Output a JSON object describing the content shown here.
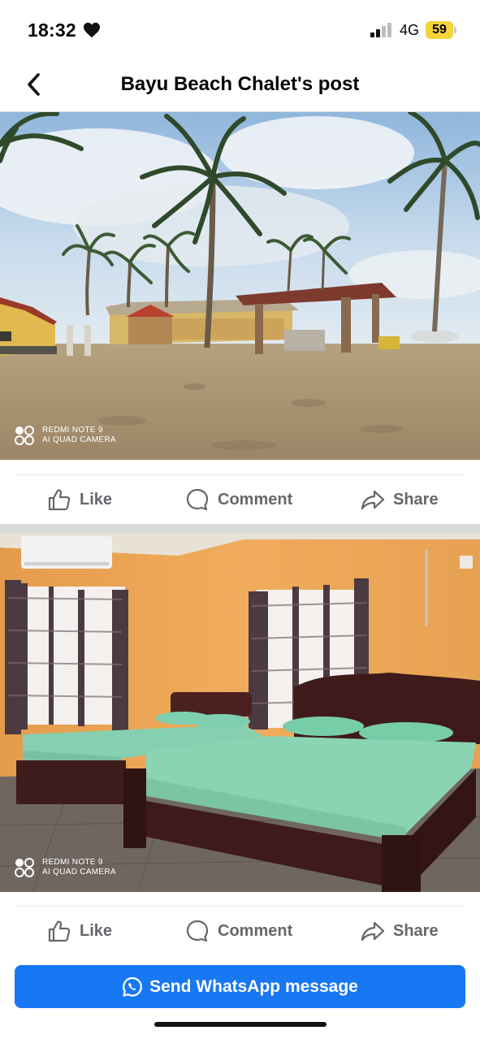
{
  "status_bar": {
    "time": "18:32",
    "network": "4G",
    "battery": "59"
  },
  "header": {
    "title": "Bayu Beach Chalet's post",
    "back_icon": "chevron-left-icon"
  },
  "posts": [
    {
      "image_description": "beach chalets with coconut palms",
      "watermark_line1": "REDMI NOTE 9",
      "watermark_line2": "AI QUAD CAMERA",
      "actions": {
        "like": "Like",
        "comment": "Comment",
        "share": "Share"
      }
    },
    {
      "image_description": "bedroom with two beds",
      "watermark_line1": "REDMI NOTE 9",
      "watermark_line2": "AI QUAD CAMERA",
      "actions": {
        "like": "Like",
        "comment": "Comment",
        "share": "Share"
      }
    }
  ],
  "cta": {
    "label": "Send WhatsApp message",
    "icon": "whatsapp-icon"
  },
  "colors": {
    "primary": "#1877f2",
    "battery": "#f5d33a",
    "action_text": "#65676b"
  }
}
